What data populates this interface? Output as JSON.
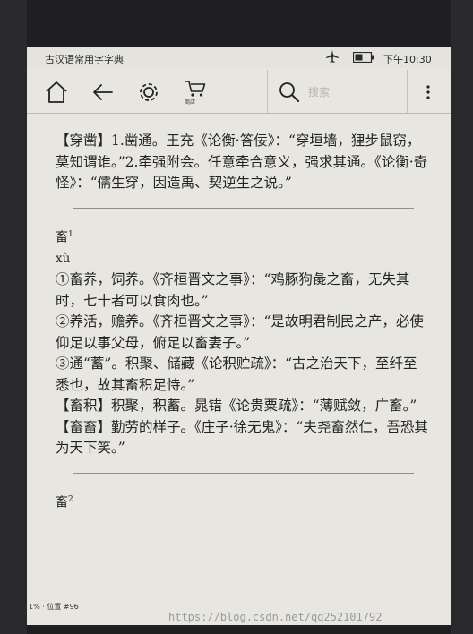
{
  "status_bar": {
    "app_title": "古汉语常用字字典",
    "time": "下午10:30"
  },
  "toolbar": {
    "store_label": "商店",
    "search_placeholder": "搜索"
  },
  "content": {
    "top_entry": "【穿凿】1.凿通。王充《论衡·答佞》：“穿垣墙，狸步鼠窃，莫知谓谁。”2.牵强附会。任意牵合意义，强求其通。《论衡·奇怪》：“儒生穿，因造禹、契逆生之说。”",
    "headword1": "畜",
    "headword1_index": "1",
    "pinyin1": "xù",
    "senses": [
      "①畜养，饲养。《齐桓晋文之事》：“鸡豚狗彘之畜，无失其时，七十者可以食肉也。”",
      "②养活，赡养。《齐桓晋文之事》：“是故明君制民之产，必使仰足以事父母，俯足以畜妻子。”",
      "③通“蓄”。积聚、储藏《论积贮疏》：“古之治天下，至纤至悉也，故其畜积足恃。”",
      "【畜积】积聚，积蓄。晁错《论贵粟疏》：“薄赋敛，广畜。”",
      "【畜畜】勤劳的样子。《庄子·徐无鬼》：“夫尧畜然仁，吾恐其为天下笑。”"
    ],
    "headword2": "畜",
    "headword2_index": "2"
  },
  "footer": {
    "progress": "1%",
    "location": "· 位置 #96"
  },
  "watermark": "https://blog.csdn.net/qq252101792"
}
